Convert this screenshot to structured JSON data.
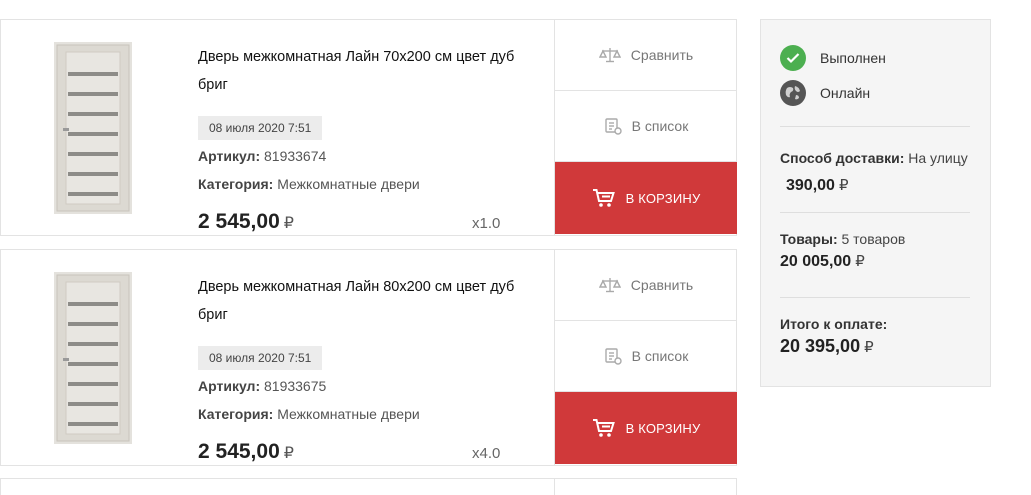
{
  "items": [
    {
      "title": "Дверь межкомнатная Лайн 70х200 см цвет дуб бриг",
      "date": "08 июля 2020 7:51",
      "article_label": "Артикул:",
      "article": "81933674",
      "category_label": "Категория:",
      "category": "Межкомнатные двери",
      "price": "2 545,00",
      "currency": "₽",
      "qty": "x1.0",
      "compare_label": "Сравнить",
      "list_label": "В список",
      "cart_label": "В корзину"
    },
    {
      "title": "Дверь межкомнатная Лайн 80х200 см цвет дуб бриг",
      "date": "08 июля 2020 7:51",
      "article_label": "Артикул:",
      "article": "81933675",
      "category_label": "Категория:",
      "category": "Межкомнатные двери",
      "price": "2 545,00",
      "currency": "₽",
      "qty": "x4.0",
      "compare_label": "Сравнить",
      "list_label": "В список",
      "cart_label": "В корзину"
    }
  ],
  "summary": {
    "status_done": "Выполнен",
    "status_online": "Онлайн",
    "delivery_label": "Способ доставки:",
    "delivery_value": "На улицу",
    "delivery_price": "390,00",
    "goods_label": "Товары:",
    "goods_count": "5 товаров",
    "goods_total": "20 005,00",
    "total_label": "Итого к оплате:",
    "total_value": "20 395,00",
    "currency": "₽"
  },
  "colors": {
    "accent": "#d0393a",
    "status_ok": "#4caf50",
    "globe": "#555555"
  },
  "icons": {
    "compare": "scales-icon",
    "list": "clipboard-list-icon",
    "cart": "cart-icon",
    "done": "check-circle-icon",
    "online": "globe-icon"
  }
}
